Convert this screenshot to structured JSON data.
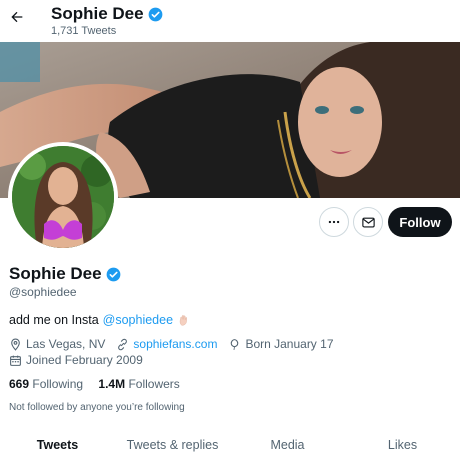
{
  "header": {
    "name": "Sophie Dee",
    "tweet_count": "1,731 Tweets"
  },
  "actions": {
    "follow_label": "Follow"
  },
  "profile": {
    "name": "Sophie Dee",
    "handle": "@sophiedee",
    "bio_text": "add me on Insta",
    "bio_mention": "@sophiedee",
    "location": "Las Vegas, NV",
    "website": "sophiefans.com",
    "birthday": "Born January 17",
    "joined": "Joined February 2009",
    "following_count": "669",
    "following_label": "Following",
    "followers_count": "1.4M",
    "followers_label": "Followers",
    "not_followed": "Not followed by anyone you’re following"
  },
  "tabs": [
    {
      "label": "Tweets",
      "active": true
    },
    {
      "label": "Tweets & replies",
      "active": false
    },
    {
      "label": "Media",
      "active": false
    },
    {
      "label": "Likes",
      "active": false
    }
  ],
  "colors": {
    "accent": "#1d9bf0",
    "text": "#0f1419",
    "secondary": "#536471",
    "follow_bg": "#0f1419"
  },
  "icons": [
    "back-arrow-icon",
    "verified-badge-icon",
    "more-icon",
    "message-icon",
    "location-icon",
    "link-icon",
    "birthday-icon",
    "calendar-icon",
    "hand-emoji-icon"
  ]
}
